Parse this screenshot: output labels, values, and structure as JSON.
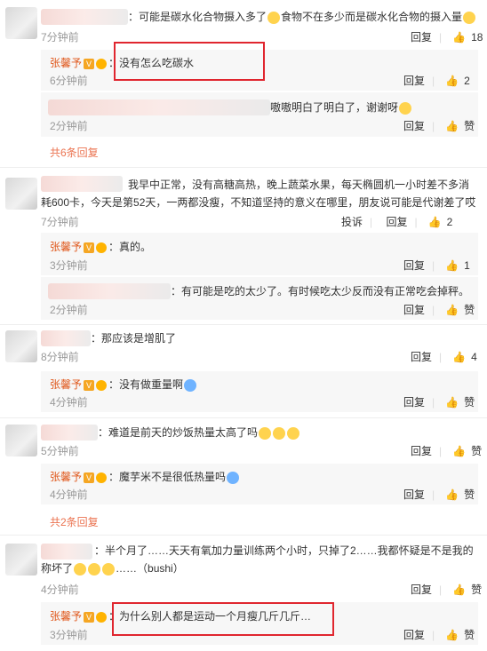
{
  "comments": [
    {
      "text": "：可能是碳水化合物摄入多了",
      "text2": "食物不在多少而是碳水化合物的摄入量",
      "time": "7分钟前",
      "reply_label": "回复",
      "likes": "18",
      "replies": [
        {
          "name": "张馨予",
          "text": "：没有怎么吃碳水",
          "time": "6分钟前",
          "reply_label": "回复",
          "likes": "2"
        },
        {
          "name": "",
          "text": "嗷嗷明白了明白了，谢谢呀",
          "time": "2分钟前",
          "reply_label": "回复",
          "likes": "赞"
        }
      ],
      "more": "共6条回复"
    },
    {
      "text": "我早中正常，没有高糖高热，晚上蔬菜水果，每天椭圆机一小时差不多消耗600卡，今天是第52天，一两都没瘦，不知道坚持的意义在哪里，朋友说可能是代谢差了哎",
      "time": "7分钟前",
      "report_label": "投诉",
      "reply_label": "回复",
      "likes": "2",
      "replies": [
        {
          "name": "张馨予",
          "text": "：真的。",
          "time": "3分钟前",
          "reply_label": "回复",
          "likes": "1"
        },
        {
          "name": "",
          "text": "：有可能是吃的太少了。有时候吃太少反而没有正常吃会掉秤。",
          "time": "2分钟前",
          "reply_label": "回复",
          "likes": "赞"
        }
      ]
    },
    {
      "text": "：那应该是增肌了",
      "time": "8分钟前",
      "reply_label": "回复",
      "likes": "4",
      "replies": [
        {
          "name": "张馨予",
          "text": "：没有做重量啊",
          "time": "4分钟前",
          "reply_label": "回复",
          "likes": "赞"
        }
      ]
    },
    {
      "text": "：难道是前天的炒饭热量太高了吗",
      "time": "5分钟前",
      "reply_label": "回复",
      "likes": "赞",
      "replies": [
        {
          "name": "张馨予",
          "text": "：魔芋米不是很低热量吗",
          "time": "4分钟前",
          "reply_label": "回复",
          "likes": "赞"
        }
      ],
      "more": "共2条回复"
    },
    {
      "text": "：半个月了……天天有氧加力量训练两个小时，只掉了2……我都怀疑是不是我的称坏了",
      "text2": "……（bushi）",
      "time": "4分钟前",
      "reply_label": "回复",
      "likes": "赞",
      "replies": [
        {
          "name": "张馨予",
          "text": "：为什么别人都是运动一个月瘦几斤几斤…",
          "time": "3分钟前",
          "reply_label": "回复",
          "likes": "赞"
        }
      ]
    }
  ],
  "icons": {
    "like": "thumbs-up-icon",
    "reply": "reply-icon",
    "verified": "verified-badge-icon",
    "level": "member-level-icon",
    "emoji": "emoji-icon"
  },
  "colors": {
    "name": "#e05a1f",
    "more": "#eb7350",
    "highlight": "#e0262f",
    "reply_bg": "#f7f7f7"
  }
}
